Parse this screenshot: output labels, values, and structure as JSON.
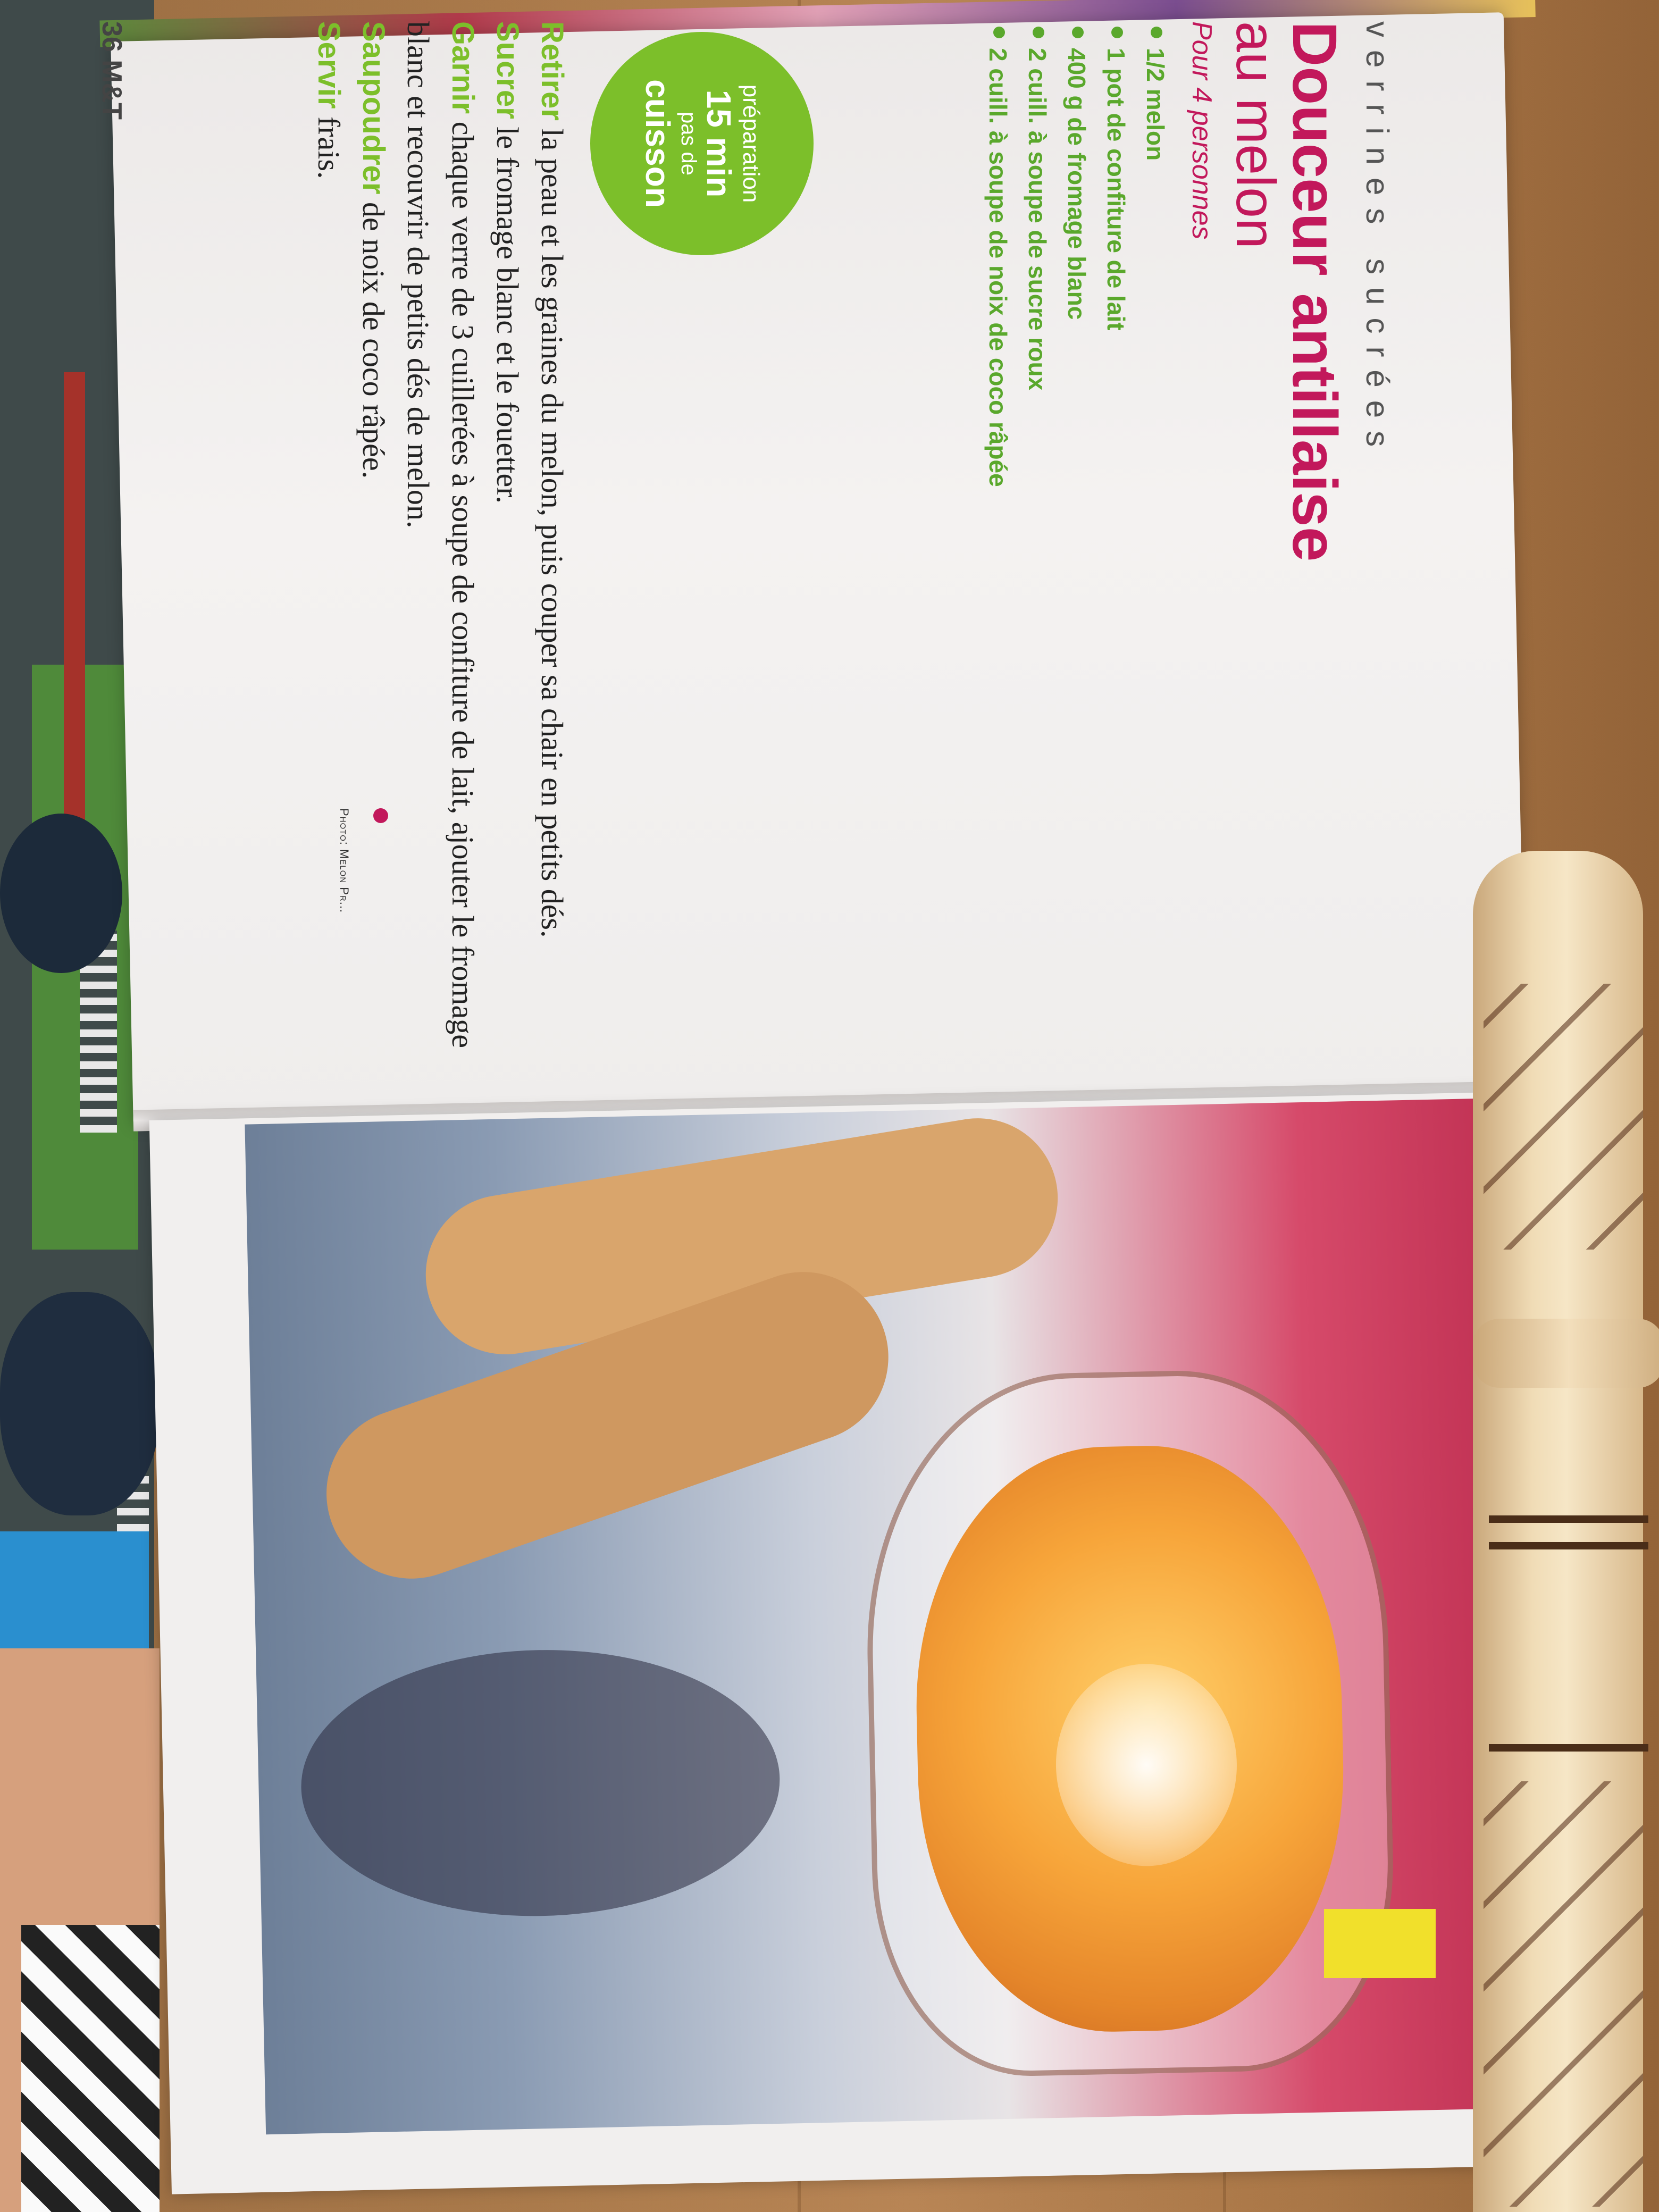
{
  "recipe": {
    "category": "verrines sucrées",
    "title_main": "Douceur antillaise",
    "title_sub": "au melon",
    "servings": "Pour 4 personnes",
    "ingredients": [
      "1/2 melon",
      "1 pot de confiture de lait",
      "400 g de fromage blanc",
      "2 cuill. à soupe de sucre roux",
      "2 cuill. à soupe de noix de coco râpée"
    ],
    "timing": {
      "prep_label": "préparation",
      "prep_value": "15 min",
      "cook_label": "pas de",
      "cook_value": "cuisson"
    },
    "steps": [
      {
        "verb": "Retirer",
        "text": " la peau et les graines du melon, puis couper sa chair en petits dés."
      },
      {
        "verb": "Sucrer",
        "text": " le fromage blanc et le fouetter."
      },
      {
        "verb": "Garnir",
        "text": " chaque verre de 3 cuillerées à soupe de confiture de lait, ajouter le fromage blanc et recouvrir de petits dés de melon."
      },
      {
        "verb": "Saupoudrer",
        "text": " de noix de coco râpée."
      },
      {
        "verb": "Servir",
        "text": " frais."
      }
    ],
    "page_number": "36",
    "publication": "M&T",
    "photo_credit": "Photo: Melon Pr..."
  },
  "colors": {
    "title": "#c2185b",
    "accent_green": "#7cbf2a",
    "ingredient_green": "#5aa82c"
  }
}
